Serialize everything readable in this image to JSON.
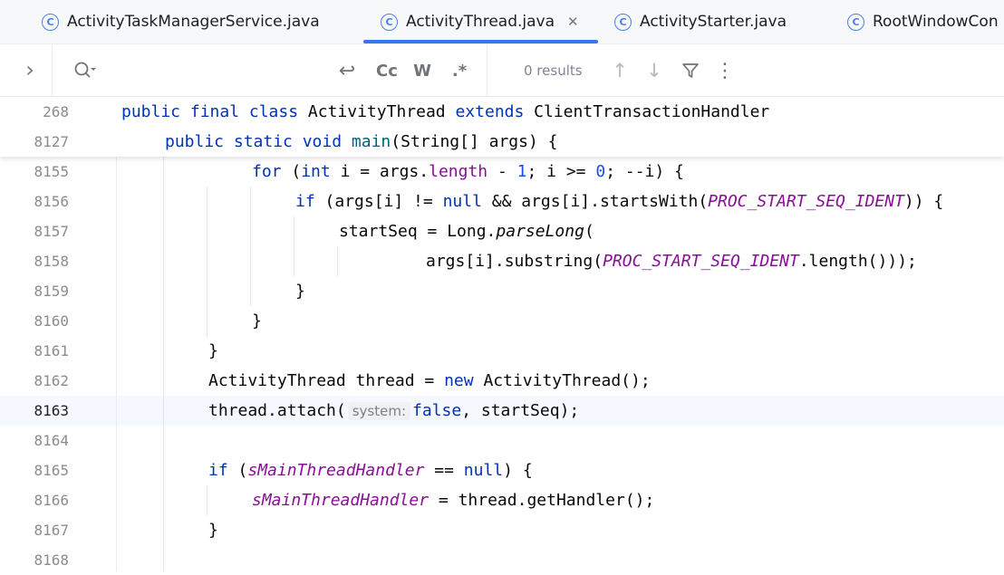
{
  "tabs": [
    {
      "label": "ActivityTaskManagerService.java",
      "icon": "class-icon",
      "active": false
    },
    {
      "label": "ActivityThread.java",
      "icon": "class-icon",
      "active": true
    },
    {
      "label": "ActivityStarter.java",
      "icon": "class-icon",
      "active": false
    },
    {
      "label": "RootWindowCon",
      "icon": "class-icon",
      "active": false
    }
  ],
  "tab_close_glyph": "✕",
  "find": {
    "expand_glyph": "›",
    "search_glyph": "Q",
    "replace_glyph": "↩",
    "match_case": "Cc",
    "words": "W",
    "regex": ".*",
    "results": "0 results",
    "prev_glyph": "↑",
    "next_glyph": "↓",
    "filter_glyph": "▽",
    "more_glyph": "⋮"
  },
  "editor": {
    "sticky": [
      {
        "number": "268",
        "parts": [
          {
            "t": "public final class ",
            "c": "kw"
          },
          {
            "t": "ActivityThread ",
            "c": ""
          },
          {
            "t": "extends ",
            "c": "kw"
          },
          {
            "t": "ClientTransactionHandler",
            "c": ""
          }
        ]
      },
      {
        "number": "8127",
        "parts": [
          {
            "t": "public static void ",
            "c": "kw"
          },
          {
            "t": "main",
            "c": "mth"
          },
          {
            "t": "(String[] args) {",
            "c": ""
          }
        ]
      }
    ],
    "lines": [
      {
        "number": "8155",
        "parts": [
          {
            "t": "for ",
            "c": "kw"
          },
          {
            "t": "(",
            "c": ""
          },
          {
            "t": "int ",
            "c": "kw"
          },
          {
            "t": "i = args.",
            "c": ""
          },
          {
            "t": "length",
            "c": "fld2"
          },
          {
            "t": " - ",
            "c": ""
          },
          {
            "t": "1",
            "c": "num"
          },
          {
            "t": "; i >= ",
            "c": ""
          },
          {
            "t": "0",
            "c": "num"
          },
          {
            "t": "; --i) {",
            "c": ""
          }
        ]
      },
      {
        "number": "8156",
        "parts": [
          {
            "t": "if ",
            "c": "kw"
          },
          {
            "t": "(args[i] != ",
            "c": ""
          },
          {
            "t": "null ",
            "c": "kw"
          },
          {
            "t": "&& args[i].startsWith(",
            "c": ""
          },
          {
            "t": "PROC_START_SEQ_IDENT",
            "c": "fld"
          },
          {
            "t": ")) {",
            "c": ""
          }
        ]
      },
      {
        "number": "8157",
        "parts": [
          {
            "t": "startSeq = Long.",
            "c": ""
          },
          {
            "t": "parseLong",
            "c": "sfn"
          },
          {
            "t": "(",
            "c": ""
          }
        ]
      },
      {
        "number": "8158",
        "parts": [
          {
            "t": "args[i].substring(",
            "c": ""
          },
          {
            "t": "PROC_START_SEQ_IDENT",
            "c": "fld"
          },
          {
            "t": ".length()));",
            "c": ""
          }
        ]
      },
      {
        "number": "8159",
        "parts": [
          {
            "t": "}",
            "c": ""
          }
        ]
      },
      {
        "number": "8160",
        "parts": [
          {
            "t": "}",
            "c": ""
          }
        ]
      },
      {
        "number": "8161",
        "parts": [
          {
            "t": "}",
            "c": ""
          }
        ]
      },
      {
        "number": "8162",
        "parts": [
          {
            "t": "ActivityThread thread = ",
            "c": ""
          },
          {
            "t": "new ",
            "c": "kw"
          },
          {
            "t": "ActivityThread();",
            "c": ""
          }
        ]
      },
      {
        "number": "8163",
        "parts": [
          {
            "t": "thread.attach(",
            "c": ""
          },
          {
            "t": "system:",
            "c": "hint"
          },
          {
            "t": "false",
            "c": "kw"
          },
          {
            "t": ", startSeq);",
            "c": ""
          }
        ]
      },
      {
        "number": "8164",
        "parts": []
      },
      {
        "number": "8165",
        "parts": [
          {
            "t": "if ",
            "c": "kw"
          },
          {
            "t": "(",
            "c": ""
          },
          {
            "t": "sMainThreadHandler",
            "c": "fld"
          },
          {
            "t": " == ",
            "c": ""
          },
          {
            "t": "null",
            "c": "kw"
          },
          {
            "t": ") {",
            "c": ""
          }
        ]
      },
      {
        "number": "8166",
        "parts": [
          {
            "t": "sMainThreadHandler",
            "c": "fld"
          },
          {
            "t": " = thread.getHandler();",
            "c": ""
          }
        ]
      },
      {
        "number": "8167",
        "parts": [
          {
            "t": "}",
            "c": ""
          }
        ]
      },
      {
        "number": "8168",
        "parts": []
      }
    ]
  }
}
